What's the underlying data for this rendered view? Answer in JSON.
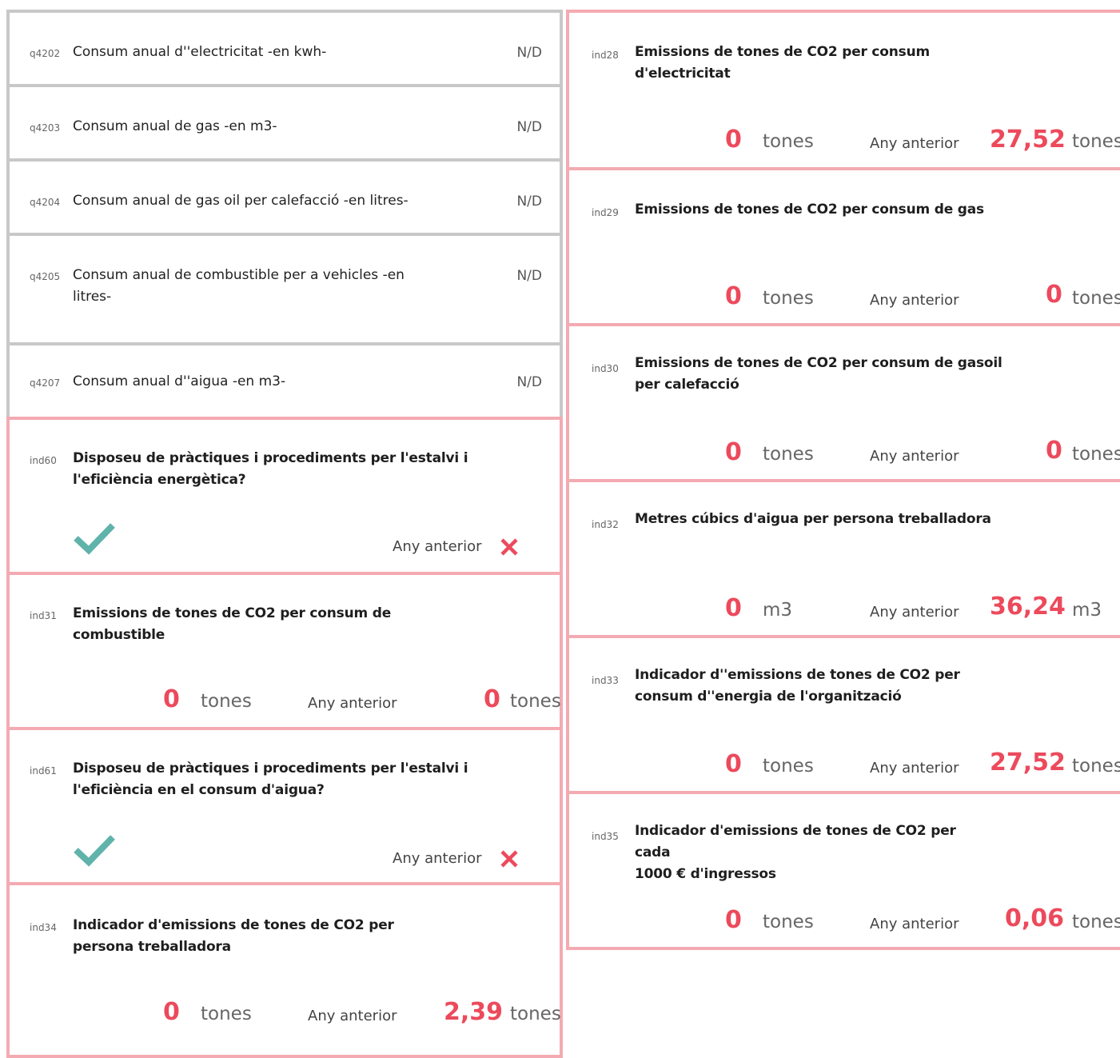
{
  "common": {
    "prev_label": "Any anterior",
    "check_color": "#5fb3ab",
    "accent_color": "#ec4a5c"
  },
  "questions": [
    {
      "code": "q4202",
      "label": "Consum anual d''electricitat -en kwh-",
      "value": "N/D"
    },
    {
      "code": "q4203",
      "label": "Consum anual de gas -en m3-",
      "value": "N/D"
    },
    {
      "code": "q4204",
      "label": "Consum anual de gas oil per calefacció -en litres-",
      "value": "N/D"
    },
    {
      "code": "q4205",
      "label": "Consum anual de combustible per a vehicles -en",
      "label2": "litres-",
      "value": "N/D"
    },
    {
      "code": "q4207",
      "label": "Consum anual d''aigua -en m3-",
      "value": "N/D"
    }
  ],
  "left_indicators": [
    {
      "code": "ind60",
      "title1": "Disposeu de pràctiques i procediments per l'estalvi i",
      "title2": "l'eficiència energètica?",
      "current": "check-icon",
      "previous": "x-icon"
    },
    {
      "code": "ind31",
      "title1": "Emissions de tones de CO2 per consum de",
      "title2": "combustible",
      "value": "0",
      "unit": "tones",
      "prev_value": "0",
      "prev_unit": "tones"
    },
    {
      "code": "ind61",
      "title1": "Disposeu de pràctiques i procediments per l'estalvi i",
      "title2": "l'eficiència en el consum d'aigua?",
      "current": "check-icon",
      "previous": "x-icon"
    },
    {
      "code": "ind34",
      "title1": "Indicador d'emissions de tones de CO2 per",
      "title2": "persona treballadora",
      "value": "0",
      "unit": "tones",
      "prev_value": "2,39",
      "prev_unit": "tones"
    }
  ],
  "right_indicators": [
    {
      "code": "ind28",
      "title1": "Emissions de tones de CO2 per consum",
      "title2": "d'electricitat",
      "value": "0",
      "unit": "tones",
      "prev_value": "27,52",
      "prev_unit": "tones"
    },
    {
      "code": "ind29",
      "title1": "Emissions de tones de CO2 per consum de gas",
      "title2": "",
      "value": "0",
      "unit": "tones",
      "prev_value": "0",
      "prev_unit": "tones"
    },
    {
      "code": "ind30",
      "title1": "Emissions de tones de CO2 per consum de gasoil",
      "title2": "per calefacció",
      "value": "0",
      "unit": "tones",
      "prev_value": "0",
      "prev_unit": "tones"
    },
    {
      "code": "ind32",
      "title1": "Metres cúbics d'aigua per persona treballadora",
      "title2": "",
      "value": "0",
      "unit": "m3",
      "prev_value": "36,24",
      "prev_unit": "m3"
    },
    {
      "code": "ind33",
      "title1": "Indicador d''emissions de tones de CO2 per",
      "title2": "consum d''energia de l'organització",
      "value": "0",
      "unit": "tones",
      "prev_value": "27,52",
      "prev_unit": "tones"
    },
    {
      "code": "ind35",
      "title1": "Indicador d'emissions de tones de CO2 per cada",
      "title2": "1000 € d'ingressos",
      "value": "0",
      "unit": "tones",
      "prev_value": "0,06",
      "prev_unit": "tones"
    }
  ]
}
